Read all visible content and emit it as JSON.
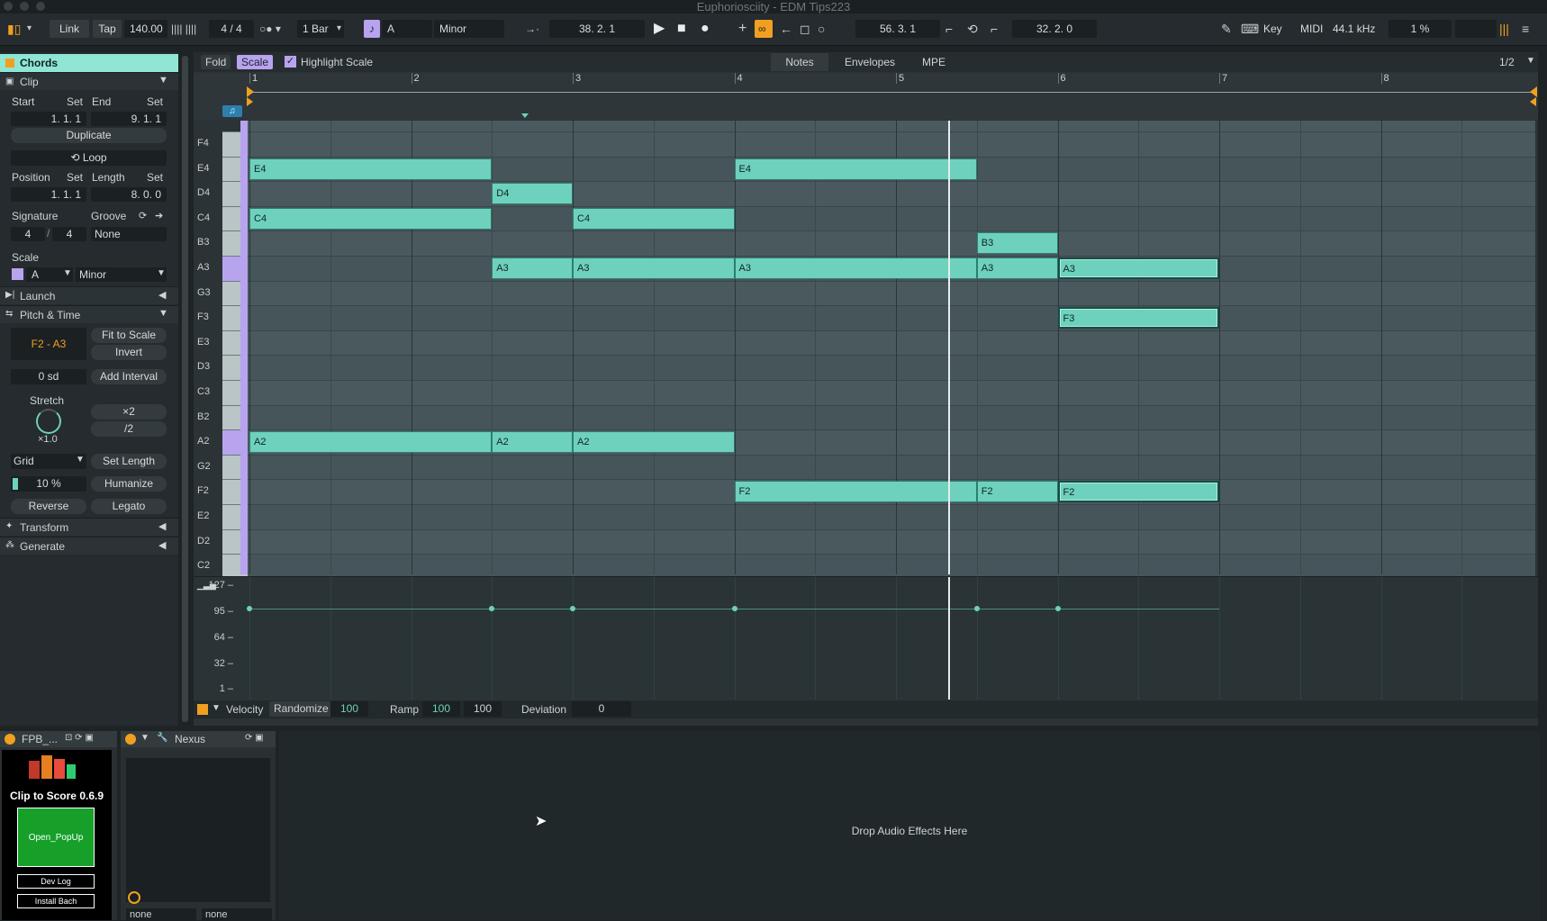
{
  "title": "Euphoriosciity - EDM Tips223",
  "toolbar": {
    "link": "Link",
    "tap": "Tap",
    "tempo": "140.00",
    "signature": "4 / 4",
    "quantize": "1 Bar",
    "key": "A",
    "scale": "Minor",
    "arrangement_position": "38.  2.  1",
    "loop_start": "56.  3.  1",
    "loop_length": "32.  2.  0",
    "key_label": "Key",
    "midi_label": "MIDI",
    "sample_rate": "44.1 kHz",
    "cpu": "1 %"
  },
  "clip_panel": {
    "track_name": "Chords",
    "clip_header": "Clip",
    "start_label": "Start",
    "end_label": "End",
    "set": "Set",
    "start_value": "1.   1.   1",
    "end_value": "9.   1.   1",
    "duplicate": "Duplicate",
    "loop": "Loop",
    "position_label": "Position",
    "length_label": "Length",
    "position_value": "1.   1.   1",
    "length_value": "8.   0.   0",
    "signature_label": "Signature",
    "groove_label": "Groove",
    "sig_num": "4",
    "sig_den": "4",
    "groove_value": "None",
    "scale_label": "Scale",
    "scale_root": "A",
    "scale_mode": "Minor",
    "launch": "Launch",
    "pitch_time": "Pitch & Time",
    "range": "F2 - A3",
    "fit_to_scale": "Fit to Scale",
    "invert": "Invert",
    "transpose": "0 sd",
    "add_interval": "Add Interval",
    "stretch_label": "Stretch",
    "stretch_value": "×1.0",
    "times2": "×2",
    "div2": "/2",
    "grid": "Grid",
    "set_length": "Set Length",
    "humanize_amount": "10 %",
    "humanize": "Humanize",
    "reverse": "Reverse",
    "legato": "Legato",
    "transform": "Transform",
    "generate": "Generate"
  },
  "editor_bar": {
    "fold": "Fold",
    "scale": "Scale",
    "highlight_scale": "Highlight Scale",
    "tabs": [
      "Notes",
      "Envelopes",
      "MPE"
    ],
    "page": "1/2"
  },
  "ruler": [
    "1",
    "2",
    "3",
    "4",
    "5",
    "6",
    "7",
    "8"
  ],
  "keys": [
    "F4",
    "E4",
    "D4",
    "C4",
    "B3",
    "A3",
    "G3",
    "F3",
    "E3",
    "D3",
    "C3",
    "B2",
    "A2",
    "G2",
    "F2",
    "E2",
    "D2",
    "C2"
  ],
  "notes": [
    {
      "pitch": "E4",
      "label": "E4",
      "start": 1.0,
      "length": 1.5
    },
    {
      "pitch": "E4",
      "label": "E4",
      "start": 4.0,
      "length": 1.5
    },
    {
      "pitch": "D4",
      "label": "D4",
      "start": 2.5,
      "length": 0.5
    },
    {
      "pitch": "C4",
      "label": "C4",
      "start": 1.0,
      "length": 1.5
    },
    {
      "pitch": "C4",
      "label": "C4",
      "start": 3.0,
      "length": 1.0
    },
    {
      "pitch": "B3",
      "label": "B3",
      "start": 5.5,
      "length": 0.5
    },
    {
      "pitch": "A3",
      "label": "A3",
      "start": 2.5,
      "length": 0.5
    },
    {
      "pitch": "A3",
      "label": "A3",
      "start": 3.0,
      "length": 1.0
    },
    {
      "pitch": "A3",
      "label": "A3",
      "start": 4.0,
      "length": 1.5
    },
    {
      "pitch": "A3",
      "label": "A3",
      "start": 5.5,
      "length": 0.5
    },
    {
      "pitch": "A3",
      "label": "A3",
      "start": 6.0,
      "length": 1.0,
      "selected": true
    },
    {
      "pitch": "F3",
      "label": "F3",
      "start": 6.0,
      "length": 1.0,
      "selected": true
    },
    {
      "pitch": "A2",
      "label": "A2",
      "start": 1.0,
      "length": 1.5
    },
    {
      "pitch": "A2",
      "label": "A2",
      "start": 2.5,
      "length": 0.5
    },
    {
      "pitch": "A2",
      "label": "A2",
      "start": 3.0,
      "length": 1.0
    },
    {
      "pitch": "F2",
      "label": "F2",
      "start": 4.0,
      "length": 1.5
    },
    {
      "pitch": "F2",
      "label": "F2",
      "start": 5.5,
      "length": 0.5
    },
    {
      "pitch": "F2",
      "label": "F2",
      "start": 6.0,
      "length": 1.0,
      "selected": true
    }
  ],
  "velocity_marks": [
    {
      "start": 1.0,
      "value": 100
    },
    {
      "start": 2.5,
      "value": 100
    },
    {
      "start": 3.0,
      "value": 100
    },
    {
      "start": 4.0,
      "value": 100
    },
    {
      "start": 5.5,
      "value": 100
    },
    {
      "start": 6.0,
      "value": 100,
      "end": 7.0
    }
  ],
  "velocity_scale": [
    "127",
    "95",
    "64",
    "32",
    "1"
  ],
  "velocity_bar": {
    "velocity": "Velocity",
    "randomize": "Randomize",
    "randomize_value": "100",
    "ramp": "Ramp",
    "ramp_start": "100",
    "ramp_end": "100",
    "deviation": "Deviation",
    "deviation_value": "0"
  },
  "devices": {
    "dev1_name": "FPB_...",
    "dev1_title": "Clip to Score 0.6.9",
    "open_popup": "Open_PopUp",
    "dev_log": "Dev Log",
    "install_bach": "Install Bach",
    "dev2_name": "Nexus",
    "sel1": "none",
    "sel2": "none",
    "drop_hint": "Drop Audio Effects Here"
  },
  "colors": {
    "note": "#6ed1bd",
    "accent": "#f0a020",
    "scale_purple": "#b8a3ef",
    "track": "#8fe6d4"
  }
}
